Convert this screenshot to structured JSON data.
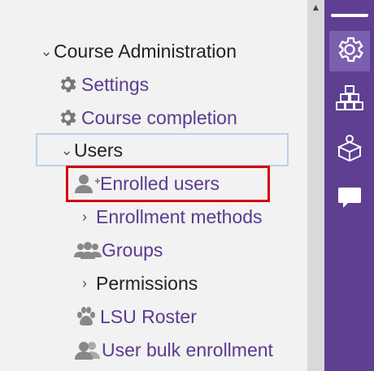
{
  "tree": {
    "course_admin": "Course Administration",
    "settings": "Settings",
    "course_completion": "Course completion",
    "users": "Users",
    "enrolled_users": "Enrolled users",
    "enrollment_methods": "Enrollment methods",
    "groups": "Groups",
    "permissions": "Permissions",
    "lsu_roster": "LSU Roster",
    "user_bulk_enrollment": "User bulk enrollment"
  },
  "icons": {
    "rail": [
      "gear-icon",
      "blocks-icon",
      "cube-person-icon",
      "chat-icon"
    ],
    "tree": [
      "gear-icon",
      "add-user-icon",
      "group-icon",
      "paw-icon",
      "users-icon"
    ]
  },
  "colors": {
    "rail": "#5e3f92",
    "link": "#5b3b8f",
    "highlight": "#d40000",
    "selection_border": "#b9d2ef"
  }
}
